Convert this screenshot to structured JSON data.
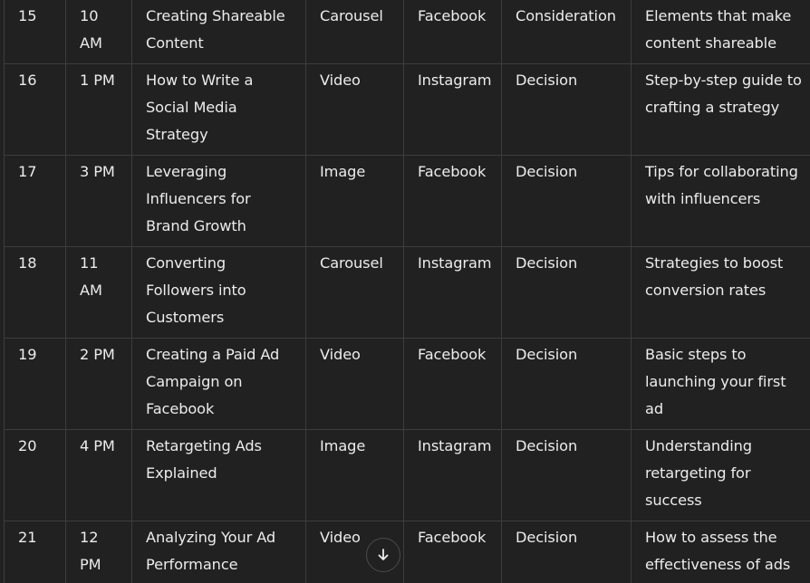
{
  "table": {
    "rows": [
      {
        "day": "15",
        "time": "10 AM",
        "title": "Creating Shareable Content",
        "format": "Carousel",
        "platform": "Facebook",
        "stage": "Consideration",
        "description": "Elements that make content shareable"
      },
      {
        "day": "16",
        "time": "1 PM",
        "title": "How to Write a Social Media Strategy",
        "format": "Video",
        "platform": "Instagram",
        "stage": "Decision",
        "description": "Step-by-step guide to crafting a strategy"
      },
      {
        "day": "17",
        "time": "3 PM",
        "title": "Leveraging Influencers for Brand Growth",
        "format": "Image",
        "platform": "Facebook",
        "stage": "Decision",
        "description": "Tips for collaborating with influencers"
      },
      {
        "day": "18",
        "time": "11 AM",
        "title": "Converting Followers into Customers",
        "format": "Carousel",
        "platform": "Instagram",
        "stage": "Decision",
        "description": "Strategies to boost conversion rates"
      },
      {
        "day": "19",
        "time": "2 PM",
        "title": "Creating a Paid Ad Campaign on Facebook",
        "format": "Video",
        "platform": "Facebook",
        "stage": "Decision",
        "description": "Basic steps to launching your first ad"
      },
      {
        "day": "20",
        "time": "4 PM",
        "title": "Retargeting Ads Explained",
        "format": "Image",
        "platform": "Instagram",
        "stage": "Decision",
        "description": "Understanding retargeting for success"
      },
      {
        "day": "21",
        "time": "12 PM",
        "title": "Analyzing Your Ad Performance",
        "format": "Video",
        "platform": "Facebook",
        "stage": "Decision",
        "description": "How to assess the effectiveness of ads"
      }
    ]
  },
  "scroll_button": {
    "icon": "arrow-down-icon"
  },
  "colors": {
    "background": "#212121",
    "text": "#ececec",
    "border": "#3d3d3d"
  }
}
